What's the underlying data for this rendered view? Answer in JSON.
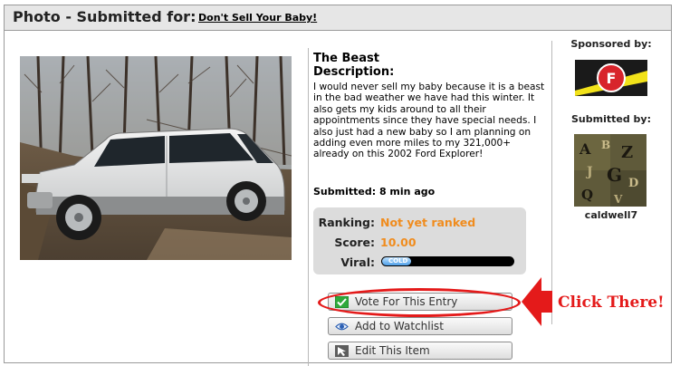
{
  "header": {
    "title": "Photo - Submitted for:",
    "contest_link": "Don't Sell Your Baby!"
  },
  "entry": {
    "title": "The Beast",
    "description_heading": "Description:",
    "description": "I would never sell my baby because it is a beast in the bad weather we have had this winter. It also gets my kids around to all their appointments since they have special needs. I also just had a new baby so I am planning on adding even more miles to my 321,000+ already on this 2002 Ford Explorer!",
    "submitted": "Submitted: 8 min ago"
  },
  "stats": {
    "ranking_label": "Ranking:",
    "ranking_value": "Not yet ranked",
    "score_label": "Score:",
    "score_value": "10.00",
    "viral_label": "Viral:",
    "viral_meter_text": "COLD",
    "viral_level": 0.22,
    "accent_color": "#f08c1e"
  },
  "actions": {
    "vote": "Vote For This Entry",
    "watchlist": "Add to Watchlist",
    "edit": "Edit This Item"
  },
  "annotation": {
    "callout": "Click There!",
    "color": "#e41a1a"
  },
  "sidebar": {
    "sponsored_by": "Sponsored by:",
    "submitted_by": "Submitted by:",
    "username": "caldwell7",
    "sponsor_logo_letter": "F"
  }
}
